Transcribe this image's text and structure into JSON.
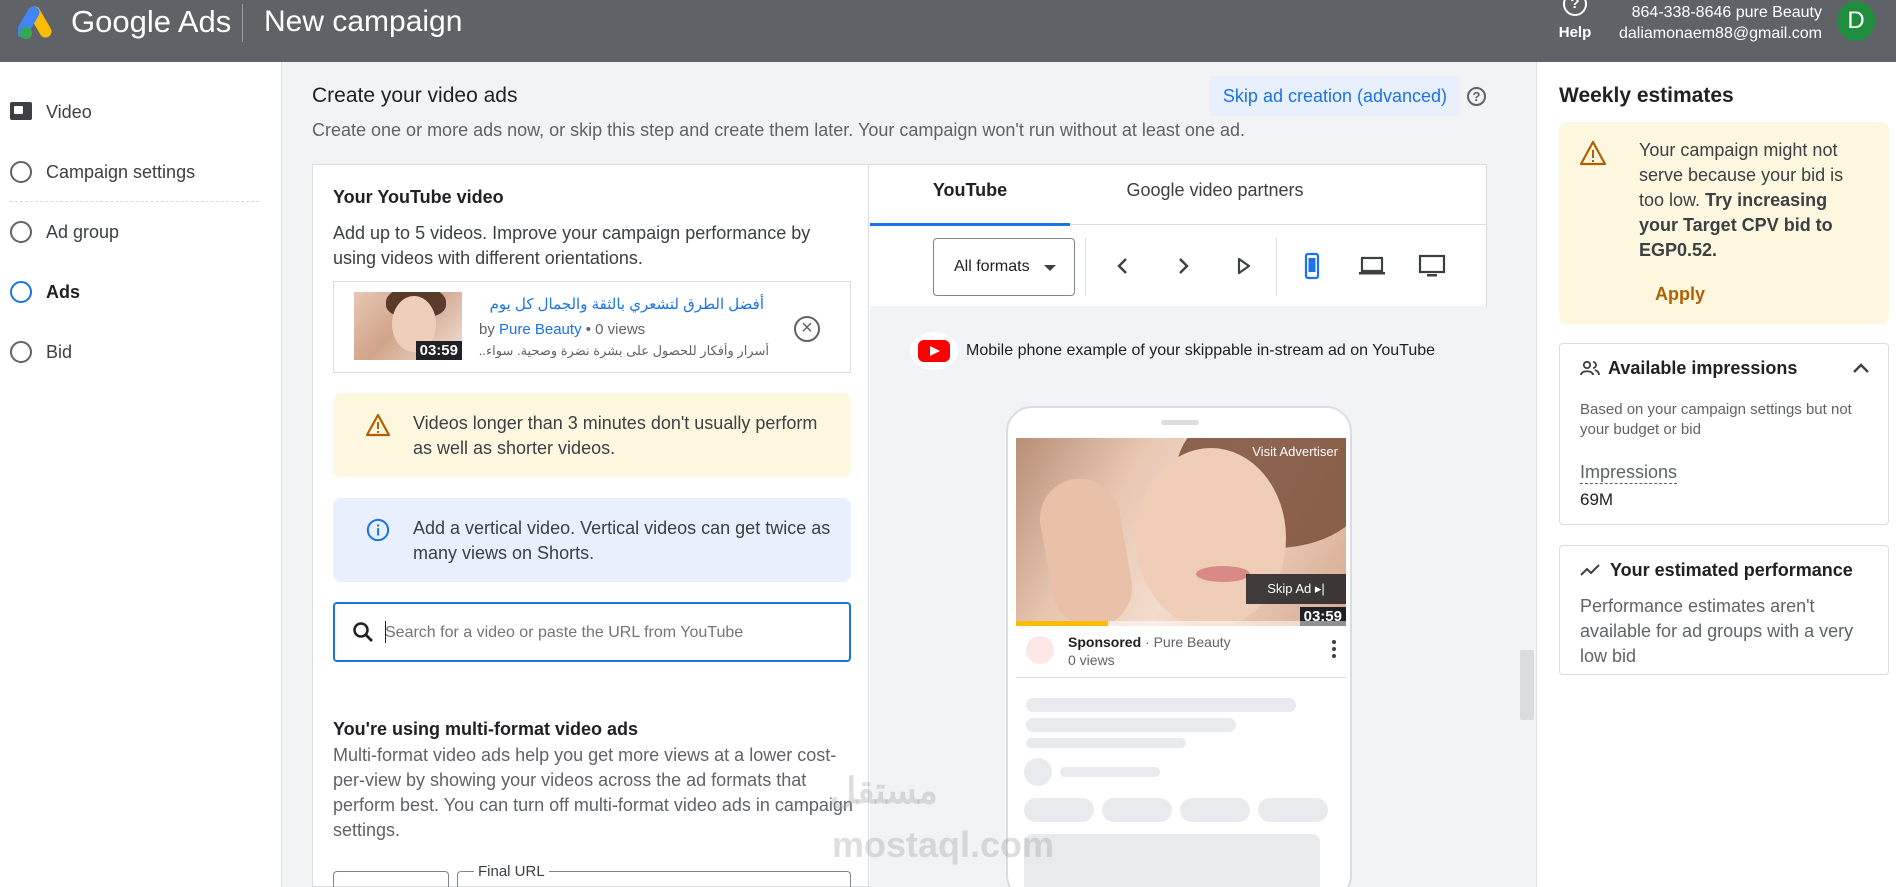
{
  "header": {
    "brand": "Google Ads",
    "page_title": "New campaign",
    "help_label": "Help",
    "account_line1": "864-338-8646 pure Beauty",
    "account_line2": "daliamonaem88@gmail.com",
    "avatar_letter": "D"
  },
  "nav": {
    "items": [
      {
        "label": "Video",
        "icon": "video-icon",
        "state": "done"
      },
      {
        "label": "Campaign settings",
        "state": "todo"
      },
      {
        "label": "Ad group",
        "state": "todo"
      },
      {
        "label": "Ads",
        "state": "active"
      },
      {
        "label": "Bid",
        "state": "todo"
      }
    ]
  },
  "main": {
    "title": "Create your video ads",
    "subtitle": "Create one or more ads now, or skip this step and create them later. Your campaign won't run without at least one ad.",
    "skip_label": "Skip ad creation (advanced)",
    "help_glyph": "?",
    "youtube_video": {
      "title": "Your YouTube video",
      "description": "Add up to 5 videos. Improve your campaign performance by using videos with different orientations.",
      "item": {
        "title": "أفضل الطرق لتشعري بالثقة والجمال كل يوم",
        "by_prefix": "by",
        "channel": "Pure Beauty",
        "views": "• 0 views",
        "description": "أسرار وأفكار للحصول على بشرة نضرة وصحية. سواء...",
        "duration": "03:59"
      }
    },
    "warning_text": "Videos longer than 3 minutes don't usually perform as well as shorter videos.",
    "info_text": "Add a vertical video. Vertical videos can get twice as many views on Shorts.",
    "search": {
      "placeholder": "Search for a video or paste the URL from YouTube",
      "value": ""
    },
    "multiformat": {
      "title": "You're using multi-format video ads",
      "text": "Multi-format video ads help you get more views at a lower cost-per-view by showing your videos across the ad formats that perform best. You can turn off multi-format video ads in campaign settings."
    },
    "final_url_label": "Final URL"
  },
  "preview": {
    "tabs": [
      "YouTube",
      "Google video partners"
    ],
    "format_select": "All formats",
    "caption": "Mobile phone example of your skippable in-stream ad on YouTube",
    "ad": {
      "visit_label": "Visit Advertiser",
      "skip_label": "Skip Ad",
      "duration": "03:59",
      "progress": 0.28,
      "sponsored": "Sponsored",
      "advertiser": "· Pure Beauty",
      "views": "0 views"
    }
  },
  "estimates": {
    "title": "Weekly estimates",
    "warning": {
      "text": "Your campaign might not serve because your bid is too low.",
      "bold": "Try increasing your Target CPV bid to EGP0.52.",
      "apply_label": "Apply"
    },
    "impressions": {
      "title": "Available impressions",
      "note": "Based on your campaign settings but not your budget or bid",
      "label": "Impressions",
      "value": "69M"
    },
    "performance": {
      "title": "Your estimated performance",
      "text": "Performance estimates aren't available for ad groups with a very low bid"
    }
  },
  "watermark": {
    "arabic": "مستقل",
    "latin": "mostaql.com"
  },
  "colors": {
    "accent": "#1a73e8",
    "header": "#5f6368",
    "warning_bg": "#fef7e0",
    "info_bg": "#e8f0fe",
    "apply": "#b06000"
  }
}
